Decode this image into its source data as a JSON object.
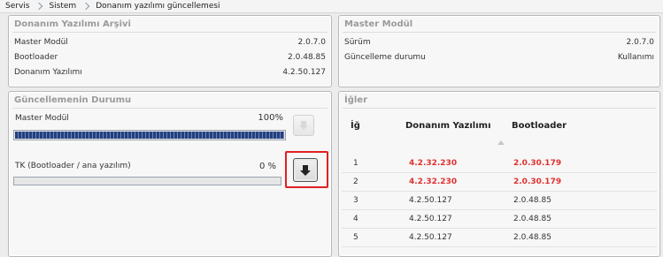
{
  "breadcrumb": {
    "items": [
      "Servis",
      "Sistem",
      "Donanım yazılımı güncellemesi"
    ]
  },
  "archive": {
    "title": "Donanım Yazılımı Arşivi",
    "rows": [
      {
        "label": "Master Modül",
        "value": "2.0.7.0"
      },
      {
        "label": "Bootloader",
        "value": "2.0.48.85"
      },
      {
        "label": "Donanım Yazılımı",
        "value": "4.2.50.127"
      }
    ]
  },
  "master_module": {
    "title": "Master Modül",
    "rows": [
      {
        "label": "Sürüm",
        "value": "2.0.7.0"
      },
      {
        "label": "Güncelleme durumu",
        "value": "Kullanımı"
      }
    ]
  },
  "update_status": {
    "title": "Güncellemenin Durumu",
    "items": [
      {
        "label": "Master Modül",
        "percent_text": "100%",
        "progress": 1.0,
        "button_state": "disabled"
      },
      {
        "label": "TK (Bootloader / ana yazılım)",
        "percent_text": "0 %",
        "progress": 0.0,
        "button_state": "enabled"
      }
    ]
  },
  "nodes": {
    "title": "İğler",
    "columns": [
      "İğ",
      "Donanım Yazılımı",
      "Bootloader"
    ],
    "rows": [
      {
        "id": "1",
        "firmware": "4.2.32.230",
        "bootloader": "2.0.30.179",
        "outdated": true
      },
      {
        "id": "2",
        "firmware": "4.2.32.230",
        "bootloader": "2.0.30.179",
        "outdated": true
      },
      {
        "id": "3",
        "firmware": "4.2.50.127",
        "bootloader": "2.0.48.85",
        "outdated": false
      },
      {
        "id": "4",
        "firmware": "4.2.50.127",
        "bootloader": "2.0.48.85",
        "outdated": false
      },
      {
        "id": "5",
        "firmware": "4.2.50.127",
        "bootloader": "2.0.48.85",
        "outdated": false
      }
    ]
  },
  "colors": {
    "accent_red": "#e03030",
    "progress_blue": "#24407e",
    "highlight": "#e02020"
  },
  "icons": [
    "chevron-right-icon",
    "download-arrow-icon",
    "sort-arrow-icon"
  ]
}
